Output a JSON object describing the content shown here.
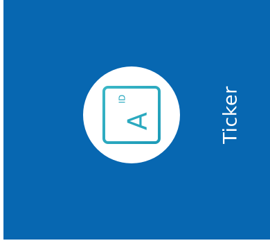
{
  "tile": {
    "label": "Ticker",
    "background_color": "#0767b1",
    "icon": {
      "name": "element-id-icon",
      "letter": "A",
      "caption": "ID",
      "stroke_color": "#2aa9bf"
    }
  }
}
